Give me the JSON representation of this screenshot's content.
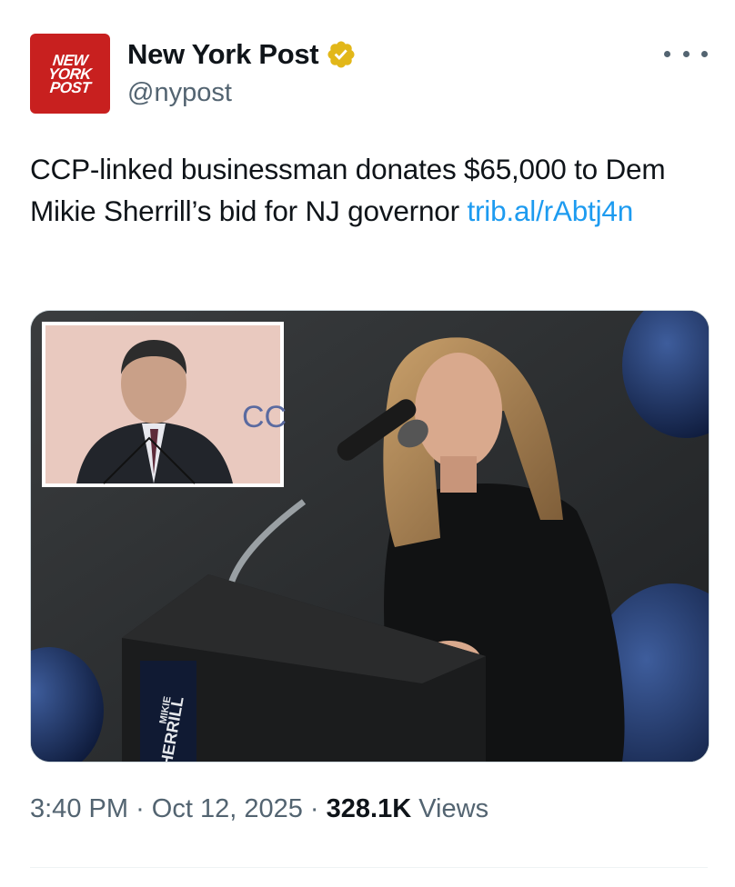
{
  "account": {
    "logo_lines": [
      "NEW",
      "YORK",
      "POST"
    ],
    "display_name": "New York Post",
    "handle": "@nypost",
    "verified_badge_color": "#e2b719"
  },
  "tweet": {
    "text": "CCP-linked businessman donates $65,000 to Dem Mikie Sherrill’s bid for NJ governor ",
    "link": "trib.al/rAbtj4n",
    "link_color": "#1d9bf0"
  },
  "media": {
    "inset_letters": "CC",
    "podium_sign": [
      "MIKIE",
      "SHERRILL"
    ]
  },
  "meta": {
    "time": "3:40 PM",
    "date": "Oct 12, 2025",
    "views_count": "328.1K",
    "views_label": "Views",
    "separator": "·"
  },
  "icons": {
    "more": "more-horizontal-icon",
    "verified": "verified-badge-icon"
  }
}
